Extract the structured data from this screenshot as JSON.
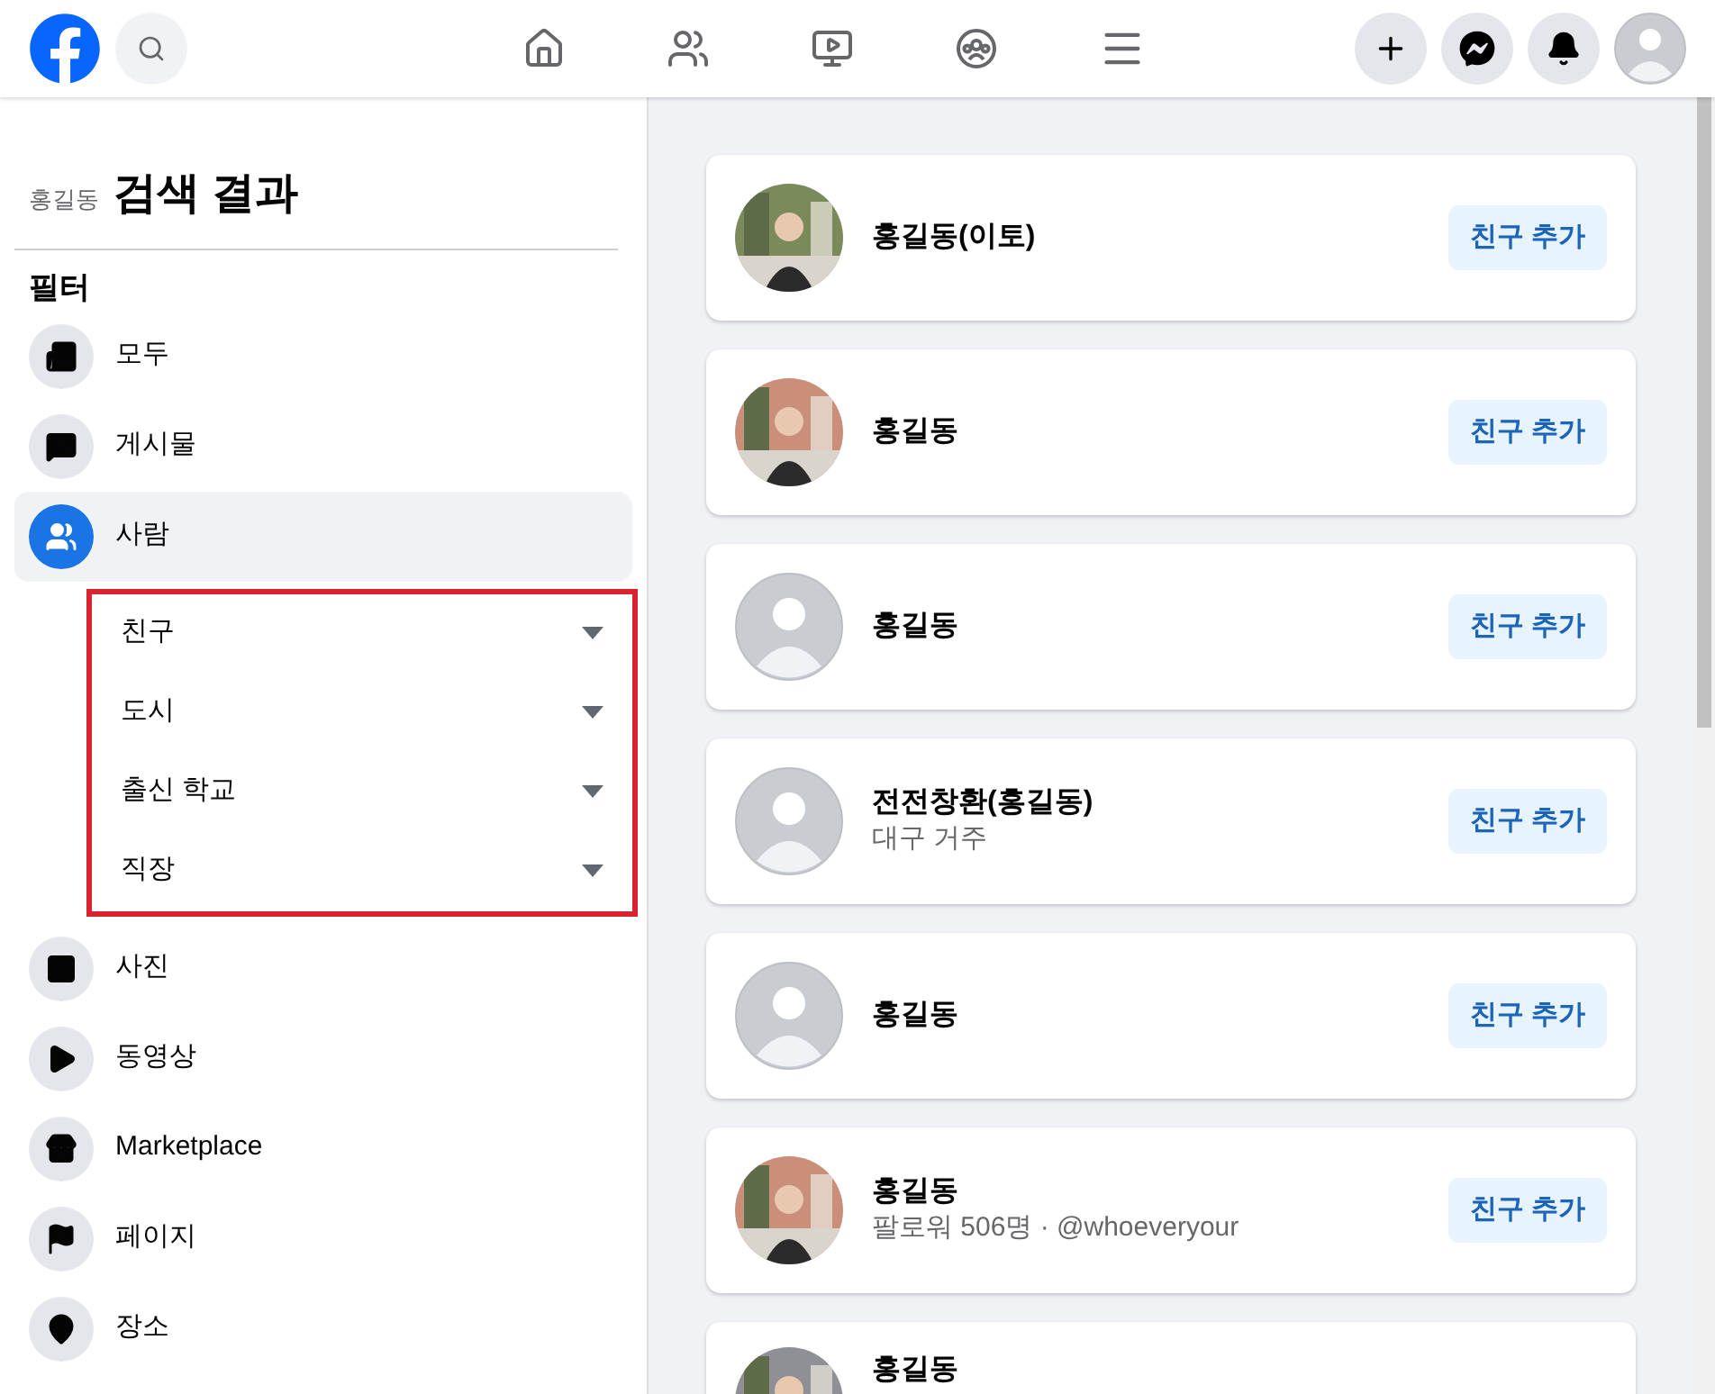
{
  "sidebar": {
    "query": "홍길동",
    "title": "검색 결과",
    "filter_heading": "필터",
    "items": [
      {
        "label": "모두",
        "kind": "all",
        "selected": false
      },
      {
        "label": "게시물",
        "kind": "posts",
        "selected": false
      },
      {
        "label": "사람",
        "kind": "people",
        "selected": true,
        "expanded": true,
        "highlighted": true,
        "children": [
          {
            "label": "친구"
          },
          {
            "label": "도시"
          },
          {
            "label": "출신 학교"
          },
          {
            "label": "직장"
          }
        ]
      },
      {
        "label": "사진",
        "kind": "photos",
        "selected": false
      },
      {
        "label": "동영상",
        "kind": "videos",
        "selected": false
      },
      {
        "label": "Marketplace",
        "kind": "marketplace",
        "selected": false
      },
      {
        "label": "페이지",
        "kind": "pages",
        "selected": false
      },
      {
        "label": "장소",
        "kind": "places",
        "selected": false
      }
    ]
  },
  "results": [
    {
      "name": "홍길동(이토)",
      "has_photo": true,
      "button": "친구 추가"
    },
    {
      "name": "홍길동",
      "has_photo": true,
      "button": "친구 추가"
    },
    {
      "name": "홍길동",
      "has_photo": false,
      "button": "친구 추가"
    },
    {
      "name": "전전창환(홍길동)",
      "detail": "대구 거주",
      "has_photo": false,
      "button": "친구 추가"
    },
    {
      "name": "홍길동",
      "has_photo": false,
      "button": "친구 추가"
    },
    {
      "name": "홍길동",
      "detail": "팔로워 506명 · @whoeveryour",
      "has_photo": true,
      "button": "친구 추가"
    },
    {
      "name": "홍길동",
      "has_photo": true
    }
  ]
}
